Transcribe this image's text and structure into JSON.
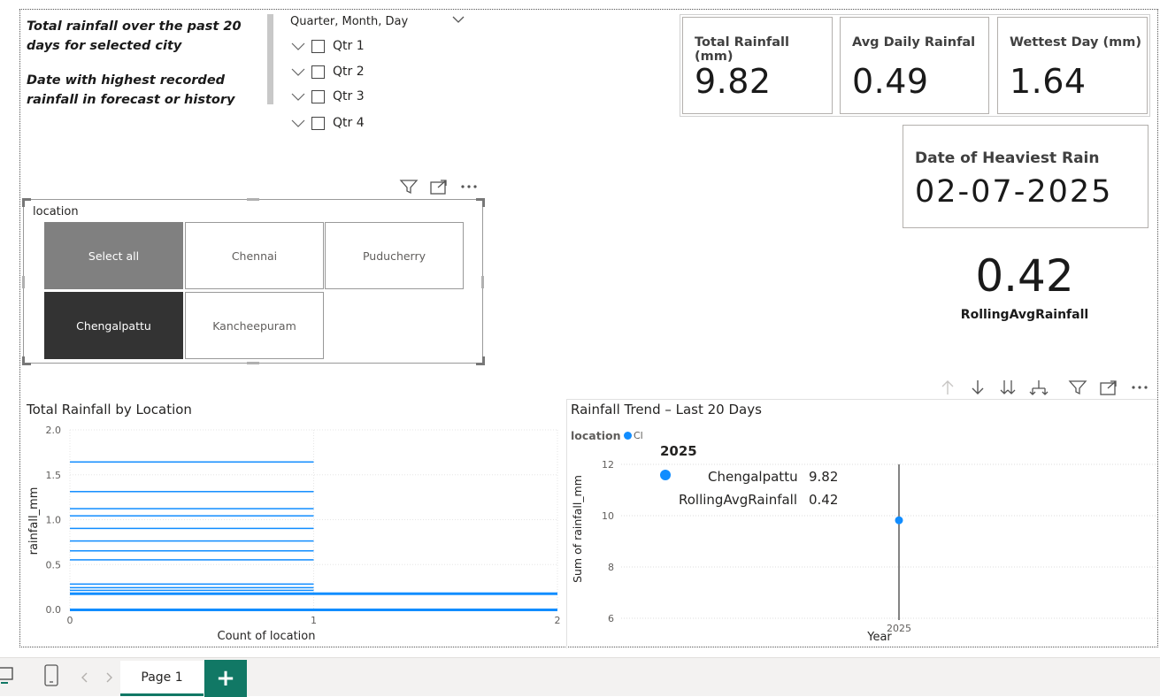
{
  "textbox": {
    "line1": "Total rainfall over the past 20 days for selected city",
    "line2": "Date with highest recorded rainfall in forecast or history"
  },
  "hierarchy_slicer": {
    "title": "Quarter, Month, Day",
    "items": [
      {
        "label": "Qtr 1"
      },
      {
        "label": "Qtr 2"
      },
      {
        "label": "Qtr 3"
      },
      {
        "label": "Qtr 4"
      }
    ]
  },
  "cards": [
    {
      "label": "Total Rainfall (mm)",
      "value": "9.82"
    },
    {
      "label": "Avg Daily Rainfal",
      "value": "0.49"
    },
    {
      "label": "Wettest Day (mm)",
      "value": "1.64"
    }
  ],
  "date_card": {
    "label": "Date of Heaviest Rain",
    "value": "02-07-2025"
  },
  "rolling_card": {
    "value": "0.42",
    "label": "RollingAvgRainfall"
  },
  "location_slicer": {
    "title": "location",
    "tiles": [
      {
        "label": "Select all",
        "state": "partial"
      },
      {
        "label": "Chennai",
        "state": "off"
      },
      {
        "label": "Puducherry",
        "state": "off"
      },
      {
        "label": "Chengalpattu",
        "state": "selected"
      },
      {
        "label": "Kancheepuram",
        "state": "off"
      }
    ]
  },
  "bar_chart": {
    "title": "Total Rainfall by Location",
    "xlabel": "Count of location",
    "ylabel": "rainfall_mm"
  },
  "trend_chart": {
    "title": "Rainfall Trend – Last 20 Days",
    "legend_title": "location",
    "legend_item": "Cl",
    "xlabel": "Year",
    "ylabel": "Sum of rainfall_mm",
    "tooltip": {
      "year": "2025",
      "rows": [
        {
          "name": "Chengalpattu",
          "value": "9.82"
        },
        {
          "name": "RollingAvgRainfall",
          "value": "0.42"
        }
      ]
    }
  },
  "bottom_bar": {
    "page_tab": "Page 1",
    "add_label": "+"
  },
  "colors": {
    "accent": "#118DFF",
    "tab_green": "#117865",
    "tile_gray": "#808080",
    "tile_dark": "#333333"
  },
  "chart_data": [
    {
      "type": "bar",
      "title": "Total Rainfall by Location",
      "xlabel": "Count of location",
      "ylabel": "rainfall_mm",
      "xlim": [
        0,
        2
      ],
      "ylim": [
        0,
        2.0
      ],
      "xticks": [
        "0",
        "1",
        "2"
      ],
      "yticks": [
        "0.0",
        "0.5",
        "1.0",
        "1.5",
        "2.0"
      ],
      "orientation": "horizontal",
      "bars": [
        {
          "y": 1.64,
          "x": 1
        },
        {
          "y": 1.31,
          "x": 1
        },
        {
          "y": 1.12,
          "x": 1
        },
        {
          "y": 1.04,
          "x": 1
        },
        {
          "y": 0.9,
          "x": 1
        },
        {
          "y": 0.76,
          "x": 1
        },
        {
          "y": 0.65,
          "x": 1
        },
        {
          "y": 0.55,
          "x": 1
        },
        {
          "y": 0.28,
          "x": 1
        },
        {
          "y": 0.24,
          "x": 1
        },
        {
          "y": 0.21,
          "x": 1
        },
        {
          "y": 0.18,
          "x": 2
        },
        {
          "y": 0.0,
          "x": 2
        }
      ],
      "grid": true
    },
    {
      "type": "scatter",
      "title": "Rainfall Trend – Last 20 Days",
      "xlabel": "Year",
      "ylabel": "Sum of rainfall_mm",
      "categories": [
        "2025"
      ],
      "yticks": [
        "6",
        "8",
        "10",
        "12"
      ],
      "ylim": [
        6,
        12
      ],
      "series": [
        {
          "name": "Chengalpattu",
          "values": [
            9.82
          ]
        }
      ],
      "grid": true
    }
  ]
}
